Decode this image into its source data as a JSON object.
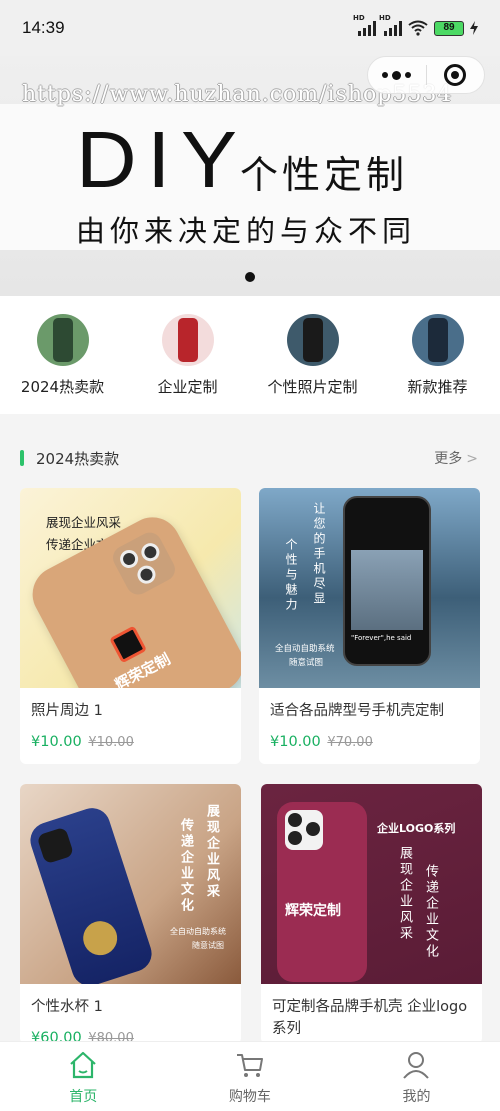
{
  "status_bar": {
    "time": "14:39",
    "battery": "89",
    "hd1": "HD",
    "hd2": "HD"
  },
  "banner": {
    "watermark": "https://www.huzhan.com/ishop5534",
    "headline": "DIY",
    "headline_sub": "个性定制",
    "slogan": "由你来决定的与众不同"
  },
  "categories": [
    {
      "label": "2024热卖款"
    },
    {
      "label": "企业定制"
    },
    {
      "label": "个性照片定制"
    },
    {
      "label": "新款推荐"
    }
  ],
  "section": {
    "title": "2024热卖款",
    "more": "更多"
  },
  "products": [
    {
      "title": "照片周边 1",
      "price": "¥10.00",
      "old_price": "¥10.00",
      "img_lines": [
        "展现企业风采",
        "传递企业文化"
      ],
      "phone_text": "辉荣定制"
    },
    {
      "title": "适合各品牌型号手机壳定制",
      "price": "¥10.00",
      "old_price": "¥70.00",
      "img_col1": "让您的手机尽显",
      "img_col2": "个性与魅力",
      "img_small1": "全自动自助系统",
      "img_small2": "随意试图",
      "img_quote": "\"Forever\",he said"
    },
    {
      "title": "个性水杯 1",
      "price": "¥60.00",
      "old_price": "¥80.00",
      "img_col1": "展现企业风采",
      "img_col2": "传递企业文化",
      "img_small1": "全自动自助系统",
      "img_small2": "随意试图"
    },
    {
      "title": "可定制各品牌手机壳 企业logo系列",
      "img_header": "企业LOGO系列",
      "img_col1": "展现企业风采",
      "img_col2": "传递企业文化",
      "phone_text": "辉荣定制"
    }
  ],
  "tabbar": [
    {
      "label": "首页",
      "icon": "home-icon"
    },
    {
      "label": "购物车",
      "icon": "cart-icon"
    },
    {
      "label": "我的",
      "icon": "user-icon"
    }
  ],
  "colors": {
    "accent": "#2cb56a",
    "price": "#19b061"
  }
}
